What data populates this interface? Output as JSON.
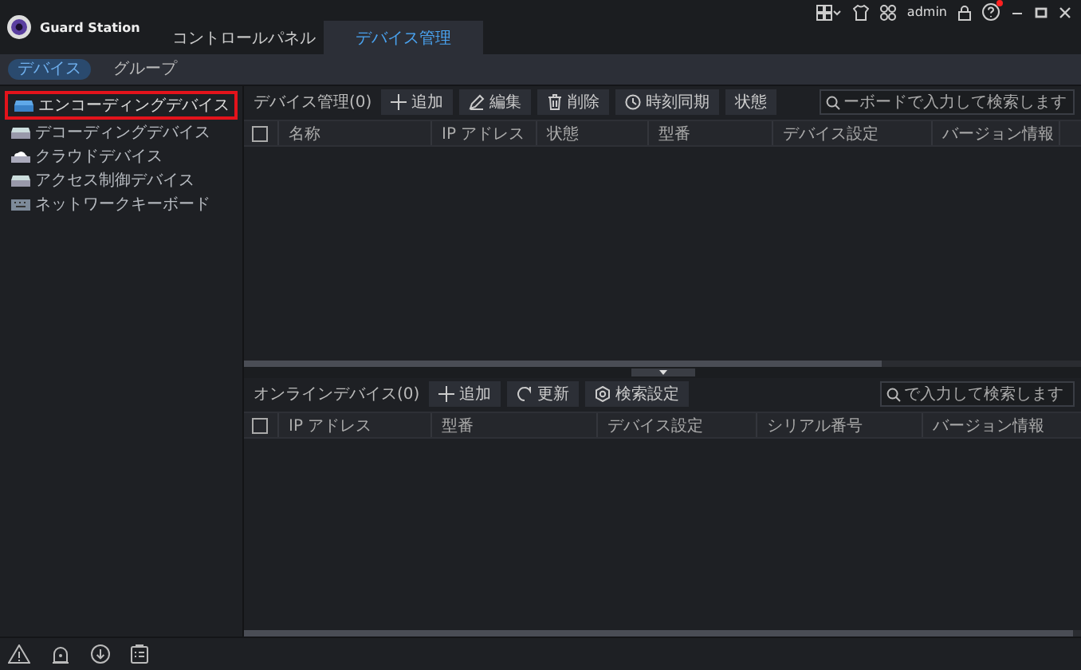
{
  "app": {
    "title": "Guard Station",
    "user": "admin",
    "notification": true
  },
  "tabs": [
    {
      "label": "コントロールパネル",
      "selected": false
    },
    {
      "label": "デバイス管理",
      "selected": true
    }
  ],
  "subtabs": [
    {
      "label": "デバイス",
      "selected": true
    },
    {
      "label": "グループ",
      "selected": false
    }
  ],
  "sidebar": {
    "items": [
      {
        "label": "エンコーディングデバイス",
        "selected": true,
        "kind": "encoder"
      },
      {
        "label": "デコーディングデバイス",
        "selected": false,
        "kind": "decoder"
      },
      {
        "label": "クラウドデバイス",
        "selected": false,
        "kind": "cloud"
      },
      {
        "label": "アクセス制御デバイス",
        "selected": false,
        "kind": "access"
      },
      {
        "label": "ネットワークキーボード",
        "selected": false,
        "kind": "keyboard"
      }
    ]
  },
  "device_panel": {
    "title": "デバイス管理(0)",
    "buttons": [
      {
        "label": "追加",
        "kind": "add"
      },
      {
        "label": "編集",
        "kind": "edit"
      },
      {
        "label": "削除",
        "kind": "delete"
      },
      {
        "label": "時刻同期",
        "kind": "clock"
      },
      {
        "label": "状態",
        "kind": "none"
      }
    ],
    "search": {
      "placeholder": "ーボードで入力して検索します"
    },
    "select_all": {
      "checked": false
    },
    "columns": [
      "名称",
      "IP アドレス",
      "状態",
      "型番",
      "デバイス設定",
      "バージョン情報"
    ]
  },
  "online_panel": {
    "title": "オンラインデバイス(0)",
    "buttons": [
      {
        "label": "追加",
        "kind": "add"
      },
      {
        "label": "更新",
        "kind": "refresh"
      },
      {
        "label": "検索設定",
        "kind": "gear"
      }
    ],
    "search": {
      "placeholder": "で入力して検索します"
    },
    "select_all": {
      "checked": false
    },
    "columns": [
      "IP アドレス",
      "型番",
      "デバイス設定",
      "シリアル番号",
      "バージョン情報"
    ]
  }
}
